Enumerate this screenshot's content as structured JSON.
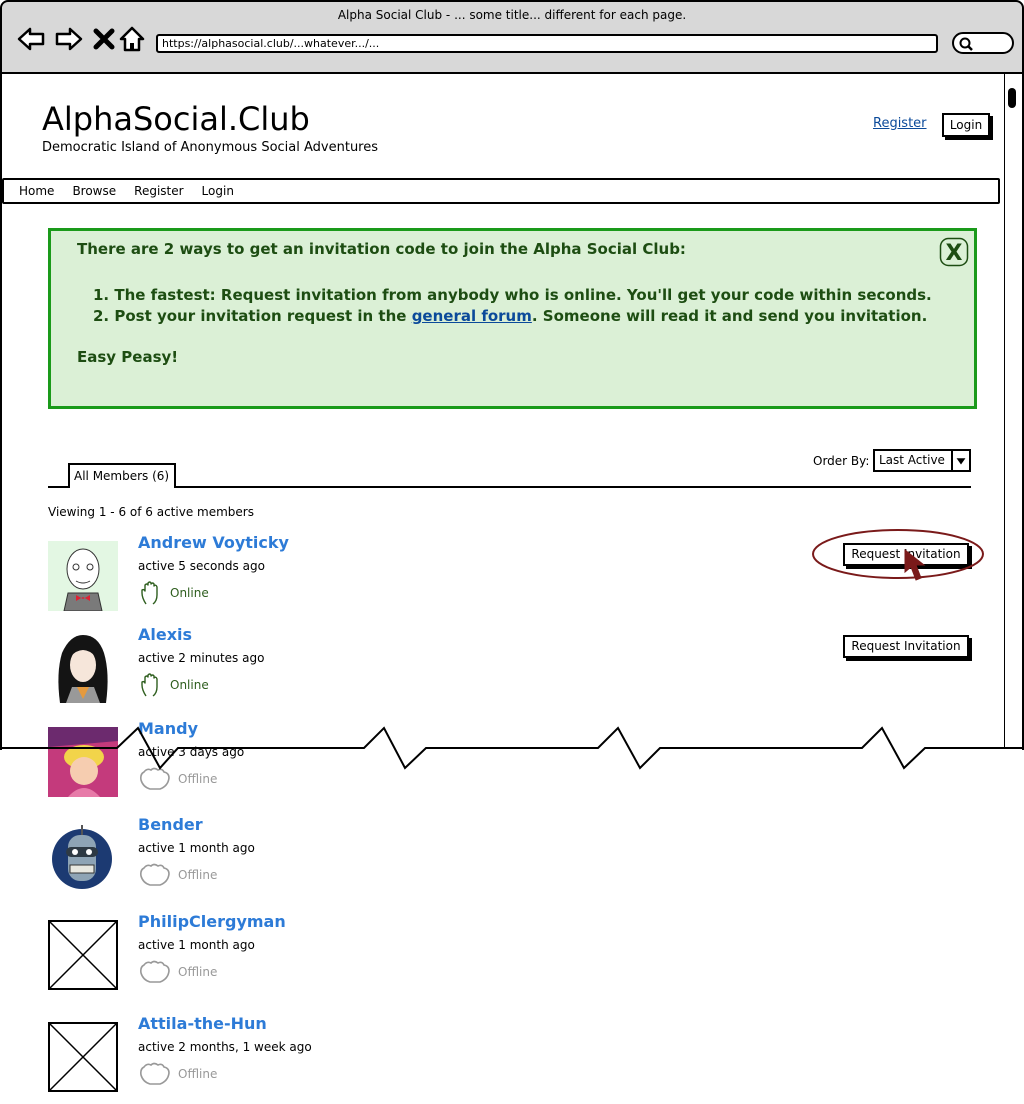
{
  "browser": {
    "title": "Alpha Social Club - ... some title... different for each page.",
    "url": "https://alphasocial.club/...whatever.../..."
  },
  "header": {
    "site_title": "AlphaSocial.Club",
    "tagline": "Democratic Island of Anonymous Social Adventures",
    "register_link": "Register",
    "login_button": "Login"
  },
  "nav": {
    "items": [
      {
        "label": "Home"
      },
      {
        "label": "Browse"
      },
      {
        "label": "Register"
      },
      {
        "label": "Login"
      }
    ]
  },
  "alert": {
    "intro": "There are 2 ways to get an invitation code to join the Alpha Social Club:",
    "item1": "1. The fastest: Request invitation from anybody who is online. You'll get your code within seconds.",
    "item2_prefix": "2. Post your invitation request in the ",
    "item2_link": "general forum",
    "item2_suffix": ". Someone will read it and send you invitation.",
    "outro": "Easy Peasy!",
    "close_glyph": "X"
  },
  "members_section": {
    "order_by_label": "Order By:",
    "order_by_value": "Last Active",
    "tab_label": "All Members (6)",
    "viewing": "Viewing 1 - 6 of 6 active members",
    "request_label": "Request Invitation"
  },
  "members": [
    {
      "name": "Andrew Voyticky",
      "active": "active 5 seconds ago",
      "status": "Online"
    },
    {
      "name": "Alexis",
      "active": "active 2 minutes ago",
      "status": "Online"
    },
    {
      "name": "Mandy",
      "active": "active 3 days ago",
      "status": "Offline"
    },
    {
      "name": "Bender",
      "active": "active 1 month ago",
      "status": "Offline"
    },
    {
      "name": "PhilipClergyman",
      "active": "active 1 month ago",
      "status": "Offline"
    },
    {
      "name": "Attila-the-Hun",
      "active": "active 2 months, 1 week ago",
      "status": "Offline"
    }
  ],
  "colors": {
    "alert_bg": "#dbf0d6",
    "alert_border": "#1a9a1a",
    "alert_text": "#1d4d12",
    "link": "#0b4a9a",
    "member_name": "#2d7bd7",
    "highlight": "#7a1a1a"
  }
}
